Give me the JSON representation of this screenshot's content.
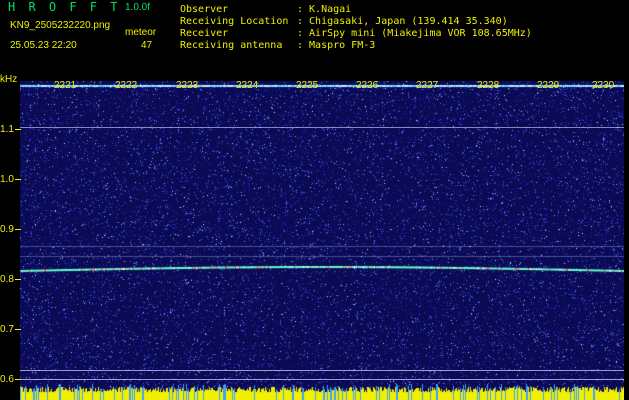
{
  "header": {
    "logo": "H R O F F T",
    "version": "1.0.0f",
    "filename": "KN9_2505232220.png",
    "datetime": "25.05.23 22:20",
    "meteor_label": "meteor",
    "meteor_count": "47",
    "fields": [
      {
        "label": "Observer",
        "value": ": K.Nagai"
      },
      {
        "label": "Receiving Location",
        "value": ": Chigasaki, Japan (139.414 35.340)"
      },
      {
        "label": "Receiver",
        "value": ": AirSpy mini (Miakejima VOR 108.65MHz)"
      },
      {
        "label": "Receiving antenna",
        "value": ": Maspro FM-3"
      }
    ]
  },
  "axis": {
    "y_unit": "kHz",
    "y_ticks": [
      "1.1",
      "1.0",
      "0.9",
      "0.8",
      "0.7",
      "0.6"
    ],
    "x_ticks": [
      "2221",
      "2222",
      "2223",
      "2224",
      "2225",
      "2226",
      "2227",
      "2228",
      "2229",
      "2230"
    ]
  },
  "colors": {
    "text": "#f0f000",
    "logo": "#00e060",
    "plot_bg": "#0a0a55",
    "noise": "#5060ff",
    "signal": "#60ffd0",
    "yellow_bar": "#f0f000"
  }
}
